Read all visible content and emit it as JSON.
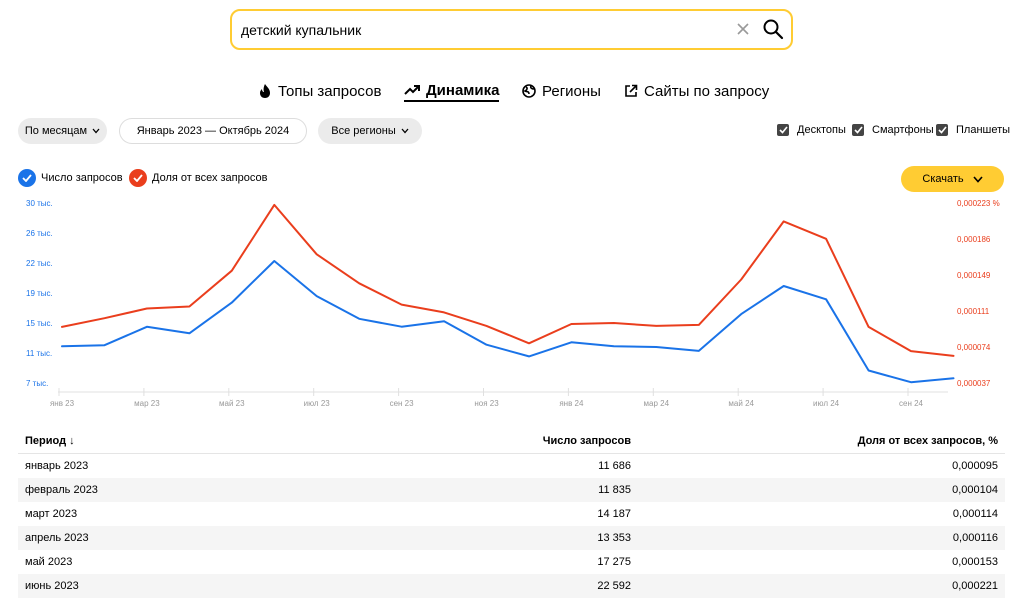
{
  "search": {
    "value": "детский купальник"
  },
  "tabs": [
    {
      "label": "Топы запросов",
      "icon": "fire-icon"
    },
    {
      "label": "Динамика",
      "icon": "trend-icon",
      "active": true
    },
    {
      "label": "Регионы",
      "icon": "globe-icon"
    },
    {
      "label": "Сайты по запросу",
      "icon": "external-link-icon"
    }
  ],
  "filters": {
    "period": "По месяцам",
    "range": "Январь 2023 — Октябрь 2024",
    "regions": "Все регионы"
  },
  "devices": [
    {
      "label": "Десктопы",
      "checked": true
    },
    {
      "label": "Смартфоны",
      "checked": true
    },
    {
      "label": "Планшеты",
      "checked": true
    }
  ],
  "legend": {
    "count_label": "Число запросов",
    "share_label": "Доля от всех запросов"
  },
  "download_label": "Скачать",
  "colors": {
    "count": "#1a73e8",
    "share": "#ea3e1d",
    "accent": "#ffcc33"
  },
  "chart_data": {
    "type": "line",
    "x": [
      "янв 23",
      "фев 23",
      "мар 23",
      "апр 23",
      "май 23",
      "июн 23",
      "июл 23",
      "авг 23",
      "сен 23",
      "окт 23",
      "ноя 23",
      "дек 23",
      "янв 24",
      "фев 24",
      "мар 24",
      "апр 24",
      "май 24",
      "июн 24",
      "июл 24",
      "авг 24",
      "сен 24",
      "окт 24"
    ],
    "x_tick_labels": [
      "янв 23",
      "мар 23",
      "май 23",
      "июл 23",
      "сен 23",
      "ноя 23",
      "янв 24",
      "мар 24",
      "май 24",
      "июл 24",
      "сен 24"
    ],
    "series": [
      {
        "name": "Число запросов",
        "axis": "left",
        "values": [
          11686,
          11835,
          14187,
          13353,
          17275,
          22592,
          18100,
          15200,
          14200,
          14900,
          11900,
          10400,
          12200,
          11700,
          11600,
          11100,
          15800,
          19400,
          17700,
          8600,
          7100,
          7600
        ]
      },
      {
        "name": "Доля от всех запросов",
        "axis": "right",
        "values": [
          9.5e-05,
          0.000104,
          0.000114,
          0.000116,
          0.000153,
          0.000221,
          0.00017,
          0.00014,
          0.000118,
          0.00011,
          9.6e-05,
          7.8e-05,
          9.8e-05,
          9.9e-05,
          9.6e-05,
          9.7e-05,
          0.000144,
          0.000204,
          0.000186,
          9.5e-05,
          7e-05,
          6.5e-05
        ]
      }
    ],
    "y_left_ticks": [
      "30 тыс.",
      "26 тыс.",
      "22 тыс.",
      "19 тыс.",
      "15 тыс.",
      "11 тыс.",
      "7 тыс."
    ],
    "y_left_range": [
      7000,
      30000
    ],
    "y_right_ticks": [
      "0,000223 %",
      "0,000186",
      "0,000149",
      "0,000111",
      "0,000074",
      "0,000037"
    ],
    "y_right_range": [
      3.7e-05,
      0.000223
    ]
  },
  "table": {
    "headers": [
      "Период ↓",
      "Число запросов",
      "Доля от всех запросов, %"
    ],
    "rows": [
      [
        "январь 2023",
        "11 686",
        "0,000095"
      ],
      [
        "февраль 2023",
        "11 835",
        "0,000104"
      ],
      [
        "март 2023",
        "14 187",
        "0,000114"
      ],
      [
        "апрель 2023",
        "13 353",
        "0,000116"
      ],
      [
        "май 2023",
        "17 275",
        "0,000153"
      ],
      [
        "июнь 2023",
        "22 592",
        "0,000221"
      ]
    ]
  }
}
